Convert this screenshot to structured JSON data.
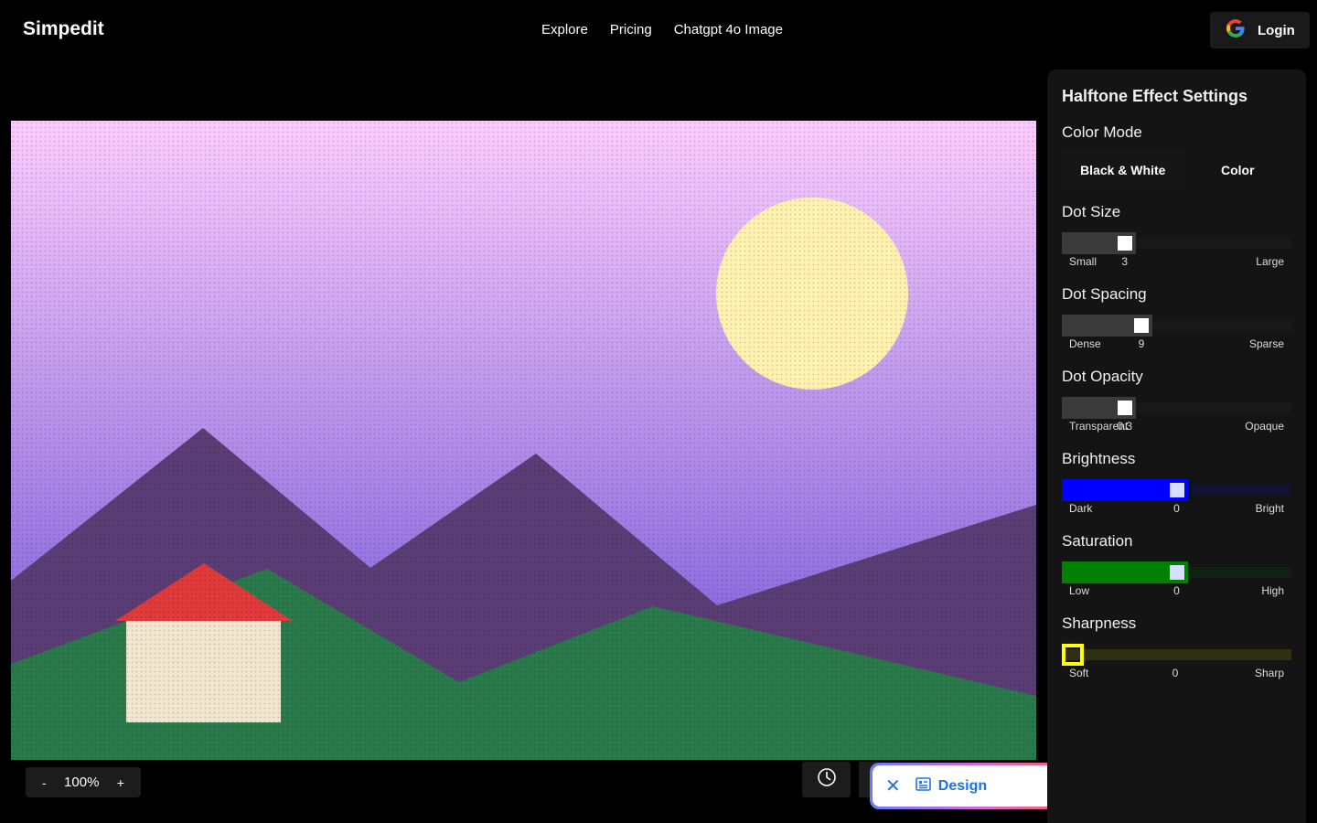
{
  "header": {
    "logo": "Simpedit",
    "nav": [
      "Explore",
      "Pricing",
      "Chatgpt 4o Image"
    ],
    "login_label": "Login"
  },
  "zoom": {
    "minus": "-",
    "level": "100%",
    "plus": "+"
  },
  "design_bar": {
    "label": "Design",
    "accent": "#1a73e8"
  },
  "panel": {
    "title": "Halftone Effect Settings",
    "color_mode": {
      "title": "Color Mode",
      "options": [
        "Black & White",
        "Color"
      ],
      "selected": "Black & White"
    },
    "sliders": [
      {
        "title": "Dot Size",
        "low": "Small",
        "value": "3",
        "high": "Large",
        "fraction": 0.25,
        "color": "#3a3a3a"
      },
      {
        "title": "Dot Spacing",
        "low": "Dense",
        "value": "9",
        "high": "Sparse",
        "fraction": 0.33,
        "color": "#3a3a3a"
      },
      {
        "title": "Dot Opacity",
        "low": "Transparent",
        "value": "0.3",
        "high": "Opaque",
        "fraction": 0.25,
        "color": "#3a3a3a"
      },
      {
        "title": "Brightness",
        "low": "Dark",
        "value": "0",
        "high": "Bright",
        "fraction": 0.5,
        "color": "#0000ff"
      },
      {
        "title": "Saturation",
        "low": "Low",
        "value": "0",
        "high": "High",
        "fraction": 0.5,
        "color": "#008000"
      },
      {
        "title": "Sharpness",
        "low": "Soft",
        "value": "0",
        "high": "Sharp",
        "fraction": 0.0,
        "color": "#ffff00"
      }
    ]
  }
}
